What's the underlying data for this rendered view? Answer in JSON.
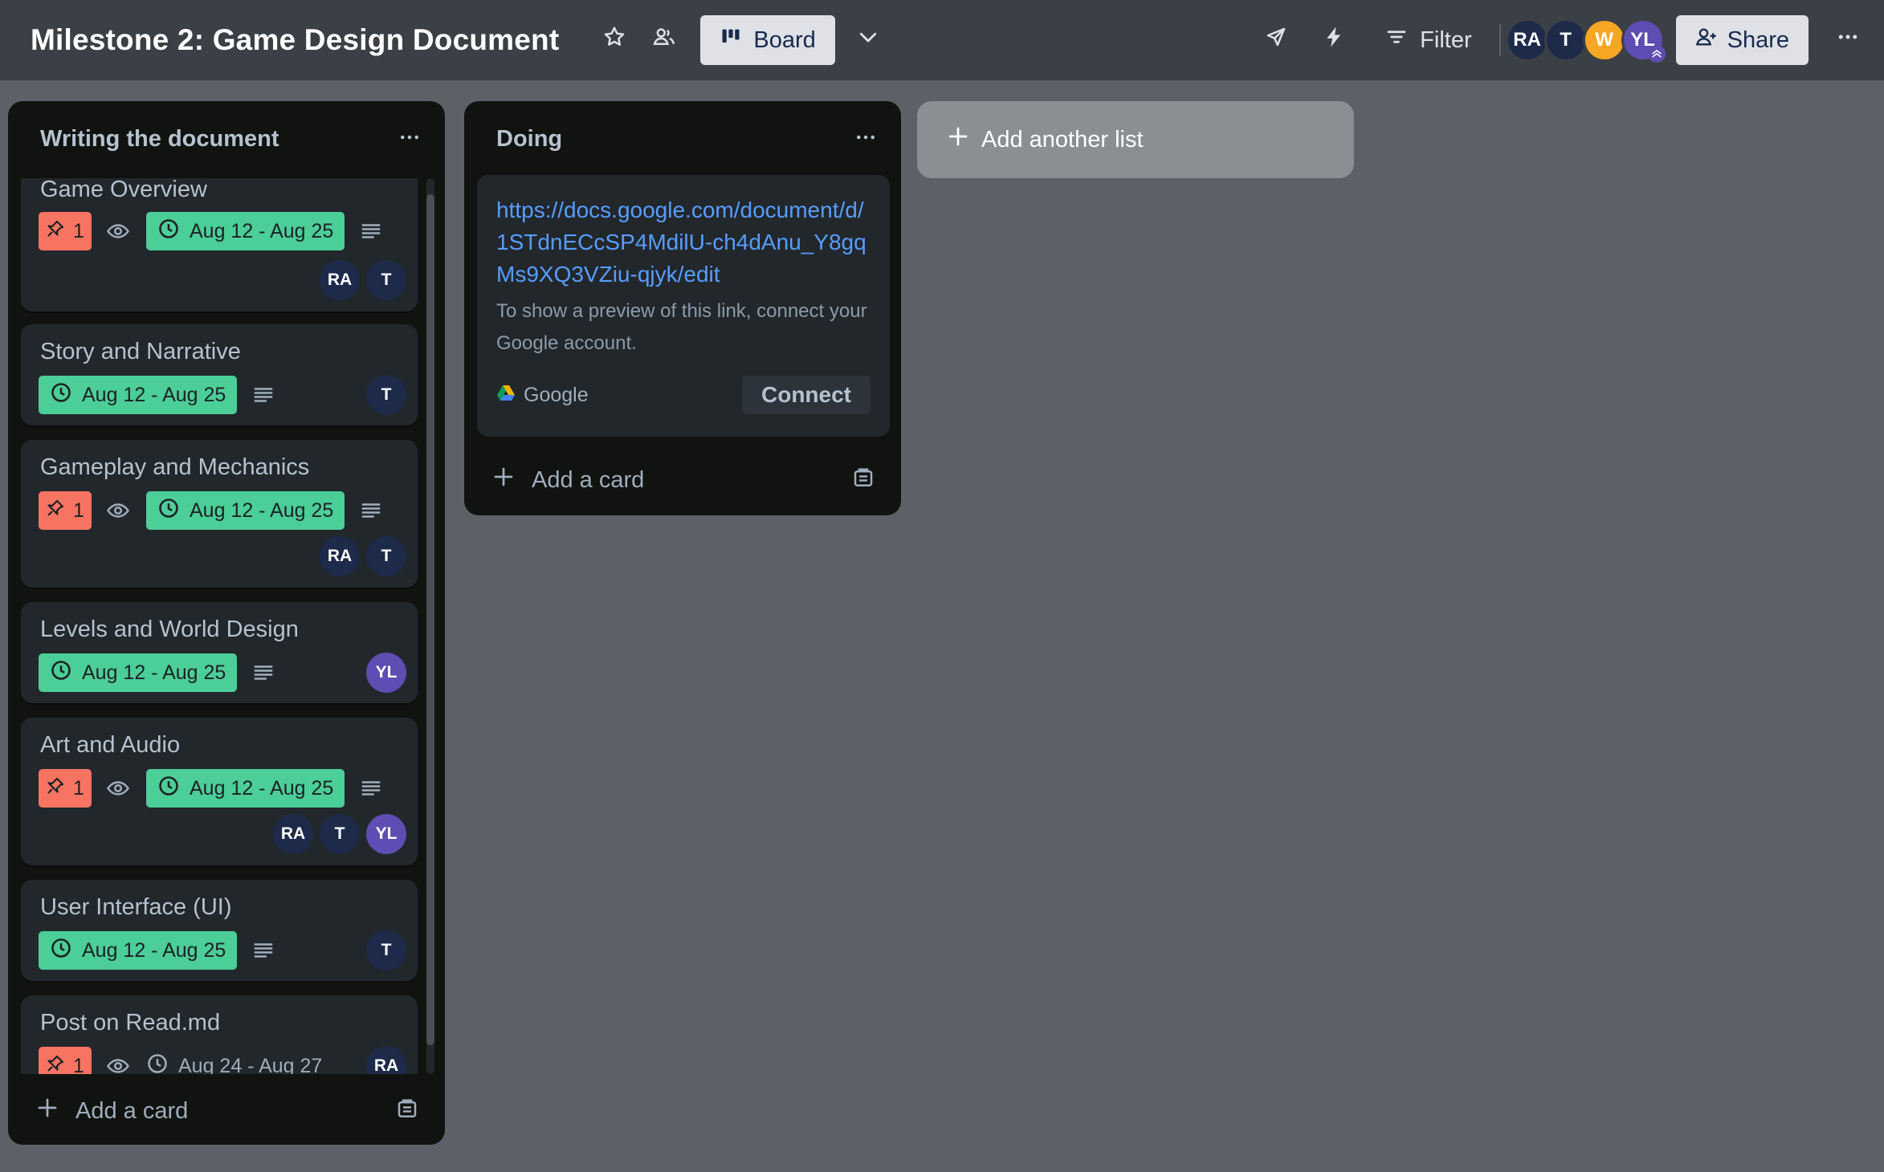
{
  "header": {
    "title": "Milestone 2: Game Design Document",
    "view_label": "Board",
    "filter_label": "Filter",
    "share_label": "Share",
    "members": [
      "RA",
      "T",
      "W",
      "YL"
    ]
  },
  "lists": [
    {
      "title": "Writing the document",
      "add_card_label": "Add a card",
      "cards": [
        {
          "title": "Game Overview",
          "priority": "1",
          "watched": true,
          "dates": "Aug 12 - Aug 25",
          "description": true,
          "members": [
            "RA",
            "T"
          ]
        },
        {
          "title": "Story and Narrative",
          "dates": "Aug 12 - Aug 25",
          "description": true,
          "members": [
            "T"
          ]
        },
        {
          "title": "Gameplay and Mechanics",
          "priority": "1",
          "watched": true,
          "dates": "Aug 12 - Aug 25",
          "description": true,
          "members": [
            "RA",
            "T"
          ]
        },
        {
          "title": "Levels and World Design",
          "dates": "Aug 12 - Aug 25",
          "description": true,
          "members": [
            "YL"
          ]
        },
        {
          "title": "Art and Audio",
          "priority": "1",
          "watched": true,
          "dates": "Aug 12 - Aug 25",
          "description": true,
          "members": [
            "RA",
            "T",
            "YL"
          ]
        },
        {
          "title": "User Interface (UI)",
          "dates": "Aug 12 - Aug 25",
          "description": true,
          "members": [
            "T"
          ]
        },
        {
          "title": "Post on Read.md",
          "priority": "1",
          "watched": true,
          "dates": "Aug 24 - Aug 27",
          "members": [
            "RA"
          ]
        }
      ]
    },
    {
      "title": "Doing",
      "add_card_label": "Add a card",
      "link_card": {
        "url": "https://docs.google.com/document/d/1STdnECcSP4MdilU-ch4dAnu_Y8gqMs9XQ3VZiu-qjyk/edit",
        "note": "To show a preview of this link, connect your Google account.",
        "provider": "Google",
        "connect_label": "Connect"
      }
    }
  ],
  "add_list_label": "Add another list",
  "colors": {
    "header_bg": "#3b4046",
    "board_bg": "#5b6166",
    "list_bg": "#111310",
    "card_bg": "#22272b",
    "date_badge": "#4bce97",
    "priority_badge": "#f87462",
    "link": "#579dff"
  }
}
